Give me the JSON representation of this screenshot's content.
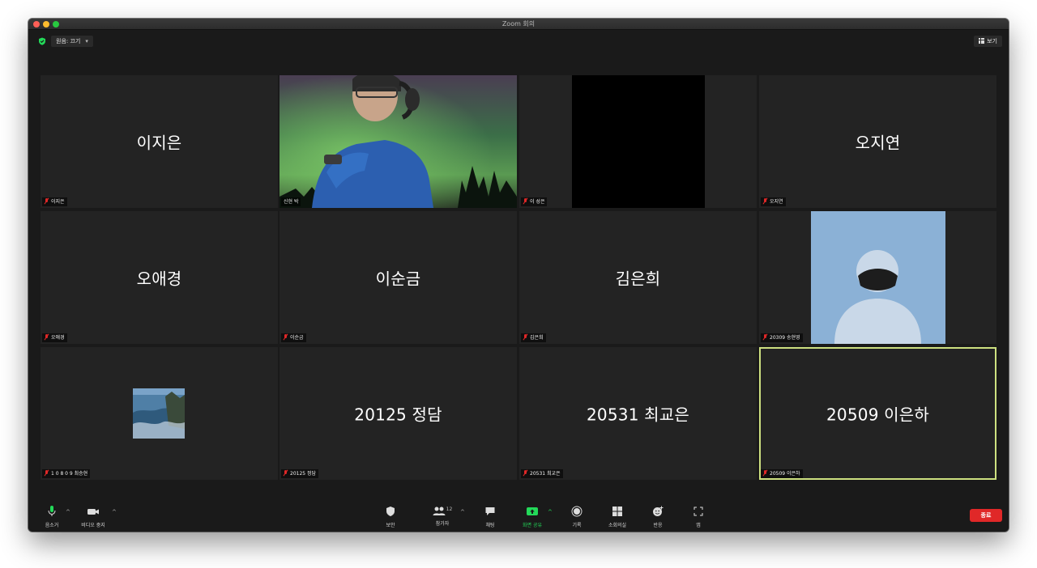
{
  "window": {
    "title": "Zoom 회의"
  },
  "topbar": {
    "original_sound": "원음: 끄기",
    "view": "보기"
  },
  "tiles": [
    {
      "center": "이지은",
      "label": "이지은"
    },
    {
      "center": "",
      "label": "신현 박"
    },
    {
      "center": "",
      "label": "이 성은"
    },
    {
      "center": "오지연",
      "label": "오지연"
    },
    {
      "center": "오애경",
      "label": "오애경"
    },
    {
      "center": "이순금",
      "label": "이순금"
    },
    {
      "center": "김은희",
      "label": "김은희"
    },
    {
      "center": "",
      "label": "20309 송현영"
    },
    {
      "center": "",
      "label": "1 0 8 0 9 최승현"
    },
    {
      "center": "20125 정담",
      "label": "20125 정담"
    },
    {
      "center": "20531 최교은",
      "label": "20531 최교은"
    },
    {
      "center": "20509 이은하",
      "label": "20509 이은하"
    }
  ],
  "toolbar": {
    "mute": "음소거",
    "stop_video": "비디오 중지",
    "security": "보안",
    "participants": "참가자",
    "participant_count": "12",
    "chat": "채팅",
    "share_screen": "화면 공유",
    "record": "기록",
    "breakout": "소회의실",
    "reactions": "반응",
    "apps": "앱",
    "end": "종료"
  },
  "colors": {
    "share_green": "#23d959",
    "end_red": "#e02828",
    "active_border": "#cde080",
    "mute_red": "#e02828"
  }
}
